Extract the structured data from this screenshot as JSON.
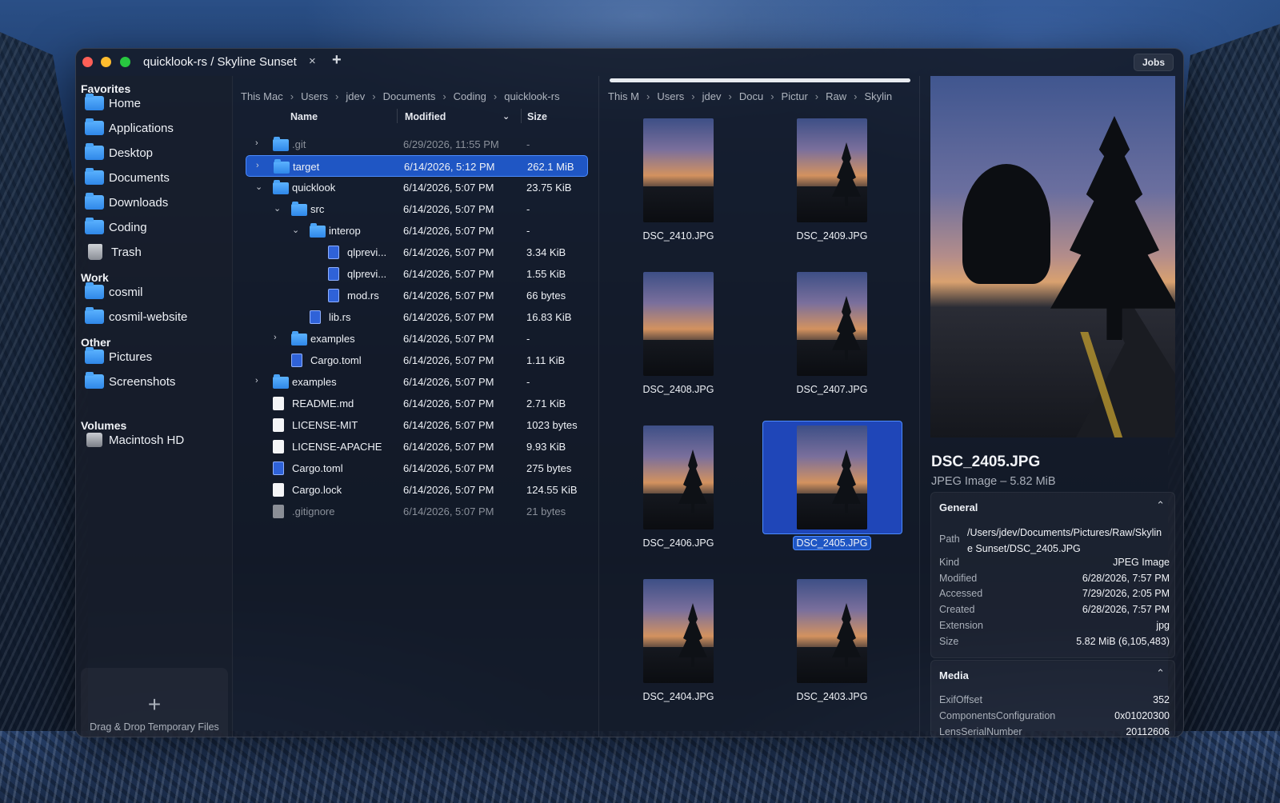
{
  "window": {
    "tab_title": "quicklook-rs / Skyline Sunset",
    "tab_close": "×",
    "tab_add": "+",
    "jobs_label": "Jobs"
  },
  "sidebar": {
    "favorites_heading": "Favorites",
    "favorites": [
      "Home",
      "Applications",
      "Desktop",
      "Documents",
      "Downloads",
      "Coding",
      "Trash"
    ],
    "work_heading": "Work",
    "work": [
      "cosmil",
      "cosmil-website"
    ],
    "other_heading": "Other",
    "other": [
      "Pictures",
      "Screenshots"
    ],
    "volumes_heading": "Volumes",
    "volumes": [
      "Macintosh HD"
    ],
    "drop_zone": {
      "plus": "+",
      "label": "Drag & Drop Temporary Files"
    }
  },
  "list": {
    "breadcrumb": [
      "This Mac",
      "Users",
      "jdev",
      "Documents",
      "Coding",
      "quicklook-rs"
    ],
    "columns": {
      "name": "Name",
      "modified": "Modified",
      "size": "Size"
    },
    "rows": [
      {
        "name": ".git",
        "modified": "6/29/2026, 11:55 PM",
        "size": "-",
        "icon": "folder-icon",
        "chevron": "›"
      },
      {
        "name": "target",
        "modified": "6/14/2026, 5:12 PM",
        "size": "262.1 MiB",
        "icon": "folder-icon",
        "chevron": "›"
      },
      {
        "name": "quicklook",
        "modified": "6/14/2026, 5:07 PM",
        "size": "23.75 KiB",
        "icon": "folder-icon",
        "chevron": "⌄"
      },
      {
        "name": "src",
        "modified": "6/14/2026, 5:07 PM",
        "size": "-",
        "icon": "folder-icon",
        "chevron": "⌄"
      },
      {
        "name": "interop",
        "modified": "6/14/2026, 5:07 PM",
        "size": "-",
        "icon": "folder-icon",
        "chevron": "⌄"
      },
      {
        "name": "qlprevi...",
        "modified": "6/14/2026, 5:07 PM",
        "size": "3.34 KiB",
        "icon": "rust-file-icon",
        "chevron": ""
      },
      {
        "name": "qlprevi...",
        "modified": "6/14/2026, 5:07 PM",
        "size": "1.55 KiB",
        "icon": "rust-file-icon",
        "chevron": ""
      },
      {
        "name": "mod.rs",
        "modified": "6/14/2026, 5:07 PM",
        "size": "66 bytes",
        "icon": "rust-file-icon",
        "chevron": ""
      },
      {
        "name": "lib.rs",
        "modified": "6/14/2026, 5:07 PM",
        "size": "16.83 KiB",
        "icon": "rust-file-icon",
        "chevron": ""
      },
      {
        "name": "examples",
        "modified": "6/14/2026, 5:07 PM",
        "size": "-",
        "icon": "folder-icon",
        "chevron": "›"
      },
      {
        "name": "Cargo.toml",
        "modified": "6/14/2026, 5:07 PM",
        "size": "1.11 KiB",
        "icon": "toml-file-icon",
        "chevron": ""
      },
      {
        "name": "examples",
        "modified": "6/14/2026, 5:07 PM",
        "size": "-",
        "icon": "folder-icon",
        "chevron": "›"
      },
      {
        "name": "README.md",
        "modified": "6/14/2026, 5:07 PM",
        "size": "2.71 KiB",
        "icon": "document-icon",
        "chevron": ""
      },
      {
        "name": "LICENSE-MIT",
        "modified": "6/14/2026, 5:07 PM",
        "size": "1023 bytes",
        "icon": "document-icon",
        "chevron": ""
      },
      {
        "name": "LICENSE-APACHE",
        "modified": "6/14/2026, 5:07 PM",
        "size": "9.93 KiB",
        "icon": "document-icon",
        "chevron": ""
      },
      {
        "name": "Cargo.toml",
        "modified": "6/14/2026, 5:07 PM",
        "size": "275 bytes",
        "icon": "toml-file-icon",
        "chevron": ""
      },
      {
        "name": "Cargo.lock",
        "modified": "6/14/2026, 5:07 PM",
        "size": "124.55 KiB",
        "icon": "document-icon",
        "chevron": ""
      },
      {
        "name": ".gitignore",
        "modified": "6/14/2026, 5:07 PM",
        "size": "21 bytes",
        "icon": "document-icon",
        "chevron": ""
      }
    ]
  },
  "grid": {
    "breadcrumb": [
      "This M",
      "Users",
      "jdev",
      "Docu",
      "Pictur",
      "Raw",
      "Skylin"
    ],
    "items": [
      "DSC_2410.JPG",
      "DSC_2409.JPG",
      "DSC_2408.JPG",
      "DSC_2407.JPG",
      "DSC_2406.JPG",
      "DSC_2405.JPG",
      "DSC_2404.JPG",
      "DSC_2403.JPG"
    ],
    "selected": "DSC_2405.JPG"
  },
  "preview": {
    "name": "DSC_2405.JPG",
    "kind_size": "JPEG Image – 5.82 MiB",
    "general": {
      "title": "General",
      "caret": "⌃",
      "path_label": "Path",
      "path": "/Users/jdev/Documents/Pictures/Raw/Skyline Sunset/DSC_2405.JPG",
      "rows": [
        {
          "k": "Kind",
          "v": "JPEG Image"
        },
        {
          "k": "Modified",
          "v": "6/28/2026, 7:57 PM"
        },
        {
          "k": "Accessed",
          "v": "7/29/2026, 2:05 PM"
        },
        {
          "k": "Created",
          "v": "6/28/2026, 7:57 PM"
        },
        {
          "k": "Extension",
          "v": "jpg"
        },
        {
          "k": "Size",
          "v": "5.82 MiB (6,105,483)"
        }
      ]
    },
    "media": {
      "title": "Media",
      "caret": "⌃",
      "rows": [
        {
          "k": "ExifOffset",
          "v": "352"
        },
        {
          "k": "ComponentsConfiguration",
          "v": "0x01020300"
        },
        {
          "k": "LensSerialNumber",
          "v": "20112606"
        }
      ]
    }
  }
}
